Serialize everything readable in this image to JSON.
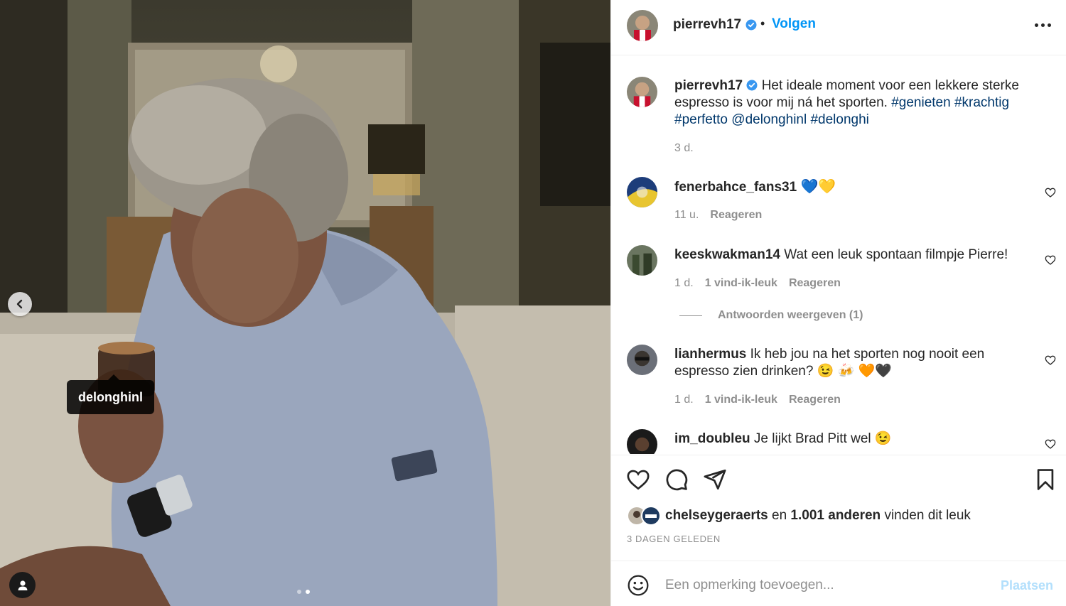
{
  "post": {
    "photo_tag": "delonghinl",
    "carousel_count": 2,
    "carousel_active": 2
  },
  "header": {
    "username": "pierrevh17",
    "separator": "•",
    "follow_label": "Volgen"
  },
  "caption": {
    "username": "pierrevh17",
    "text": "Het ideale moment voor een lekkere sterke espresso is voor mij ná het sporten.",
    "hashtags": [
      "#genieten",
      "#krachtig",
      "#perfetto"
    ],
    "mention": "@delonghinl",
    "last_tag": "#delonghi",
    "time": "3 d."
  },
  "comments": [
    {
      "username": "fenerbahce_fans31",
      "text": "💙💛",
      "time": "11 u.",
      "likes": "",
      "reply": "Reageren"
    },
    {
      "username": "keeskwakman14",
      "text": "Wat een leuk spontaan filmpje Pierre!",
      "time": "1 d.",
      "likes": "1 vind-ik-leuk",
      "reply": "Reageren",
      "view_replies": "Antwoorden weergeven (1)"
    },
    {
      "username": "lianhermus",
      "text": "Ik heb jou na het sporten nog nooit een espresso zien drinken? 😉 🍻 🧡🖤",
      "time": "1 d.",
      "likes": "1 vind-ik-leuk",
      "reply": "Reageren"
    },
    {
      "username": "im_doubleu",
      "text": "Je lijkt Brad Pitt wel 😉"
    }
  ],
  "likes": {
    "first_user": "chelseygeraerts",
    "connector": "en",
    "others": "1.001 anderen",
    "suffix": "vinden dit leuk"
  },
  "timestamp": "3 DAGEN GELEDEN",
  "add_comment": {
    "placeholder": "Een opmerking toevoegen...",
    "post_label": "Plaatsen"
  },
  "icons": [
    "chevron-left-icon",
    "user-tag-icon",
    "verified-badge-icon",
    "more-icon",
    "heart-icon",
    "comment-icon",
    "share-icon",
    "bookmark-icon",
    "emoji-icon"
  ],
  "colors": {
    "accent": "#0095f6",
    "link": "#00376b",
    "muted": "#8e8e8e",
    "text": "#262626",
    "disabled": "#b2dffc"
  }
}
